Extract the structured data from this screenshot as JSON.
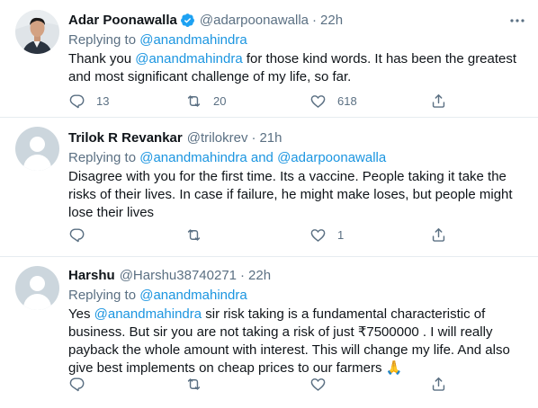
{
  "tweets": [
    {
      "name": "Adar Poonawalla",
      "verified": true,
      "handle": "@adarpoonawalla",
      "dot": "·",
      "time": "22h",
      "replying_label": "Replying to",
      "replying_to": [
        "@anandmahindra"
      ],
      "replying_join": "",
      "text_parts": [
        {
          "text": "Thank you "
        },
        {
          "text": "@anandmahindra",
          "link": true
        },
        {
          "text": " for those kind words. It has been the greatest and most significant challenge of my life, so far."
        }
      ],
      "reply_count": "13",
      "retweet_count": "20",
      "like_count": "618"
    },
    {
      "name": "Trilok R Revankar",
      "verified": false,
      "handle": "@trilokrev",
      "dot": "·",
      "time": "21h",
      "replying_label": "Replying to",
      "replying_to": [
        "@anandmahindra",
        "@adarpoonawalla"
      ],
      "replying_join": "and",
      "text_parts": [
        {
          "text": "Disagree with you for the first time. Its a vaccine.  People taking it take the risks of their lives. In case if failure, he might make loses, but people might lose their lives"
        }
      ],
      "reply_count": "",
      "retweet_count": "",
      "like_count": "1"
    },
    {
      "name": "Harshu",
      "verified": false,
      "handle": "@Harshu38740271",
      "dot": "·",
      "time": "22h",
      "replying_label": "Replying to",
      "replying_to": [
        "@anandmahindra"
      ],
      "replying_join": "",
      "text_parts": [
        {
          "text": "Yes "
        },
        {
          "text": "@anandmahindra",
          "link": true
        },
        {
          "text": "  sir risk taking is a fundamental characteristic of business. But sir  you are not taking a risk of just ₹7500000 . I  will really payback the whole amount with interest. This will change my life. And also give best implements on cheap prices to our farmers 🙏"
        }
      ],
      "reply_count": "",
      "retweet_count": "",
      "like_count": ""
    }
  ],
  "icons": {
    "reply": "reply-icon",
    "retweet": "retweet-icon",
    "like": "heart-icon",
    "share": "share-icon",
    "more": "more-icon",
    "verified": "verified-badge-icon"
  },
  "colors": {
    "link": "#1b95e0",
    "muted": "#5b7083",
    "text": "#0f1419",
    "verified": "#1da1f2",
    "divider": "#e6ecf0"
  }
}
